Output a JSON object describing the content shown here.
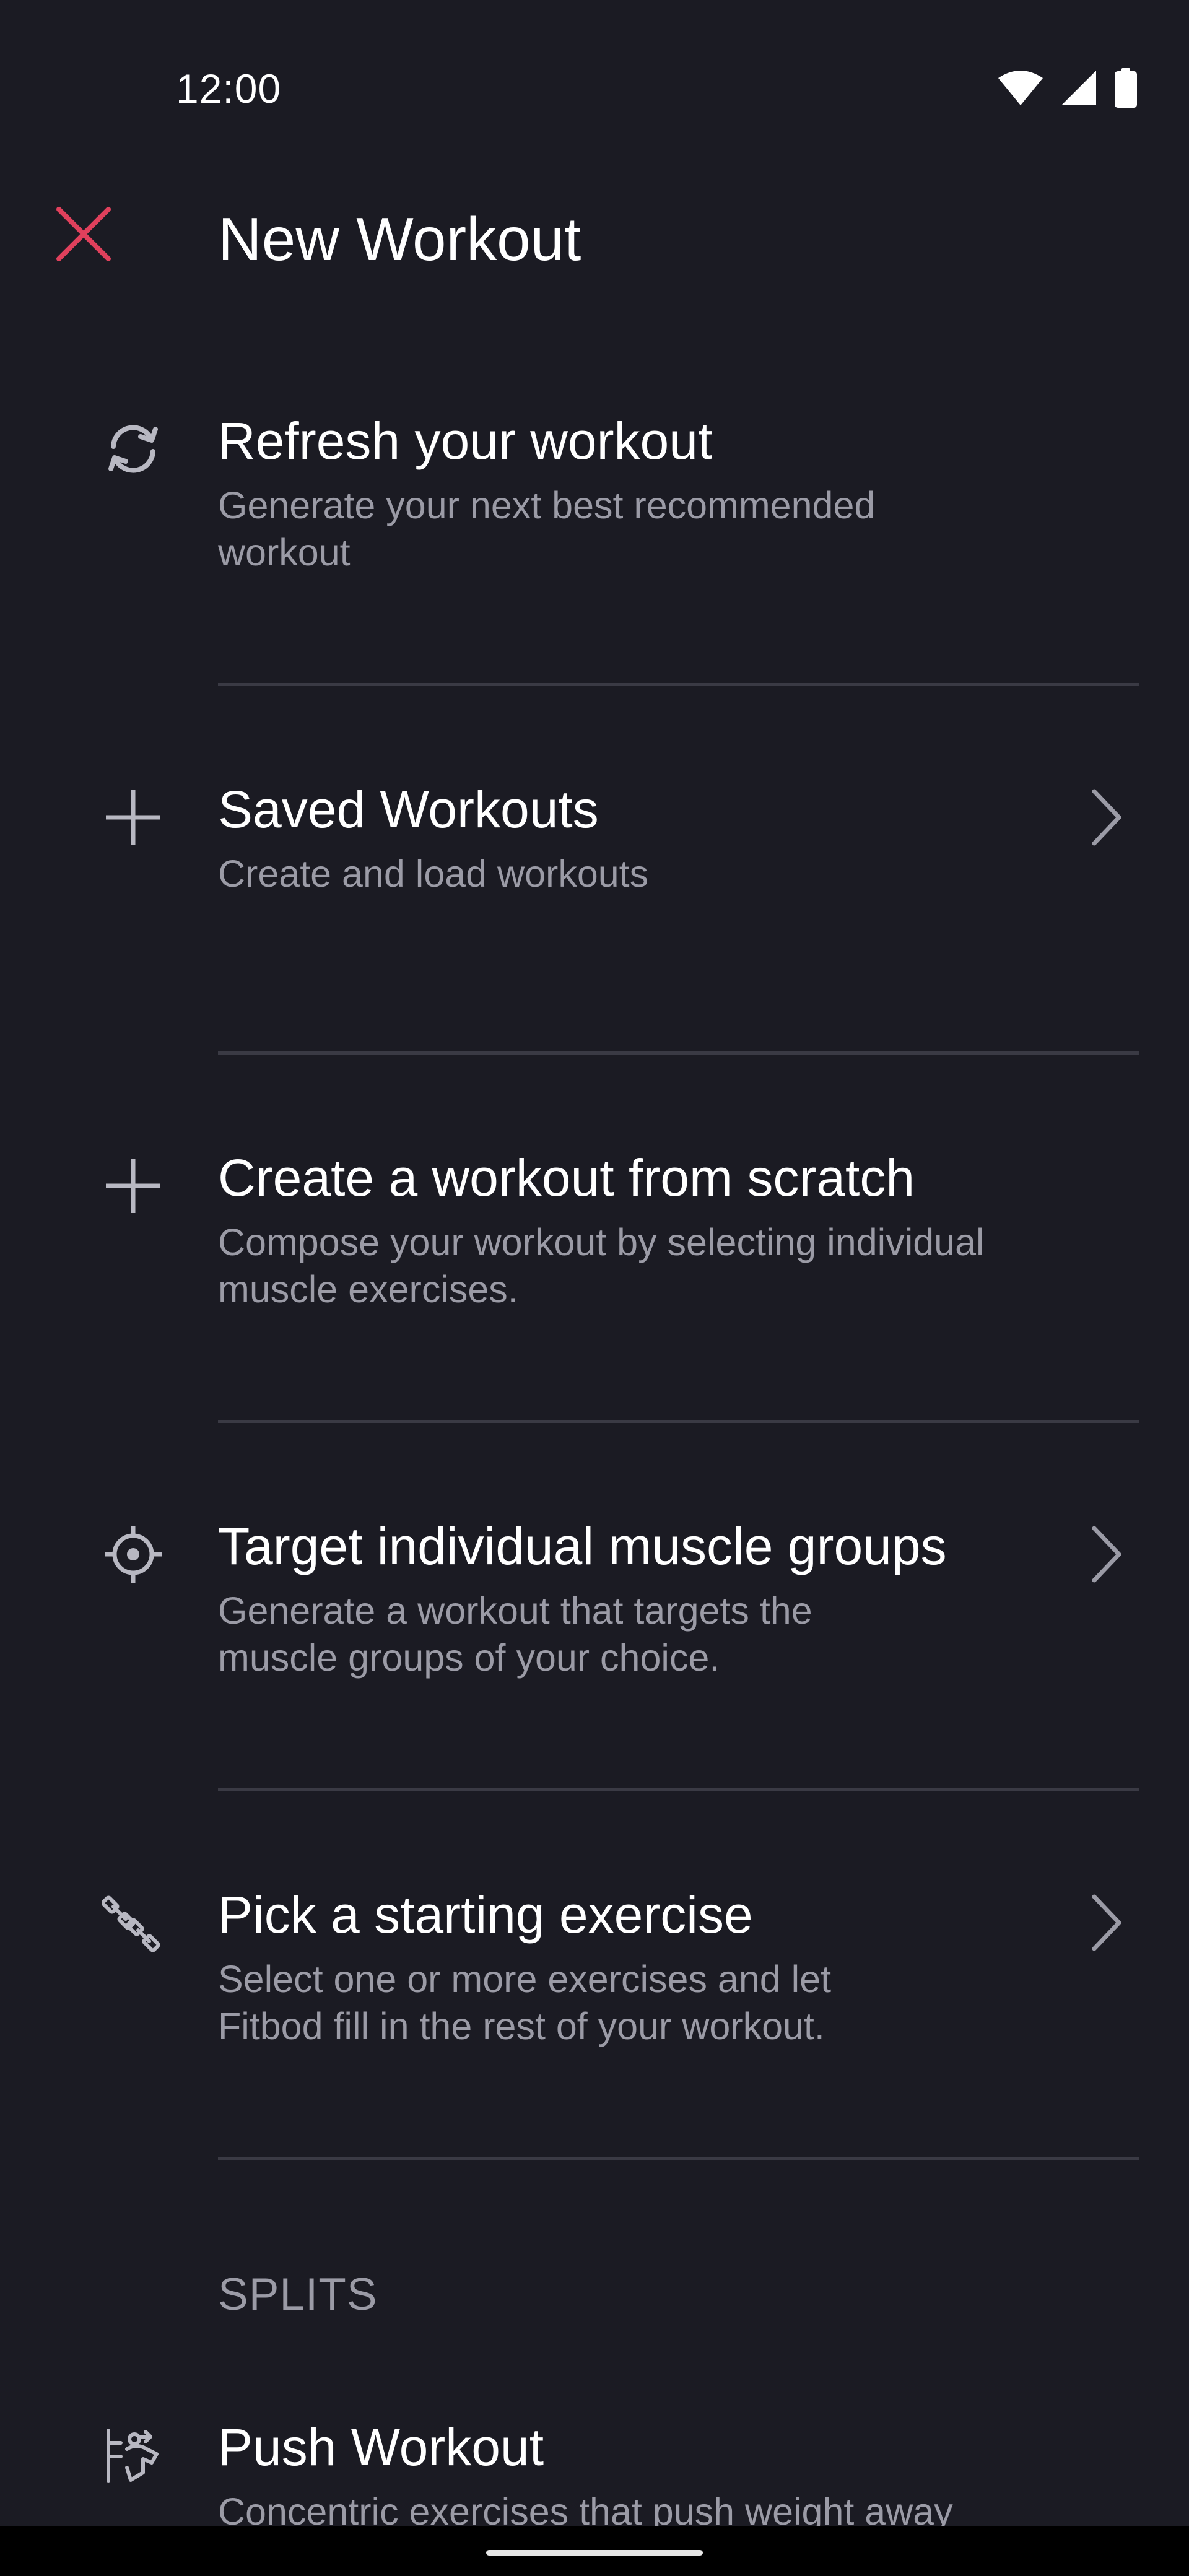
{
  "status_bar": {
    "time": "12:00"
  },
  "app_bar": {
    "title": "New Workout",
    "close_icon": "close-icon",
    "accent_color": "#e0405c"
  },
  "menu": {
    "items": [
      {
        "icon": "refresh-icon",
        "title": "Refresh your workout",
        "subtitle": "Generate your next best recommended workout",
        "has_chevron": false
      },
      {
        "icon": "plus-icon",
        "title": "Saved Workouts",
        "subtitle": "Create and load workouts",
        "has_chevron": true
      },
      {
        "icon": "plus-icon",
        "title": "Create a workout from scratch",
        "subtitle": "Compose your workout by selecting individual muscle exercises.",
        "has_chevron": false
      },
      {
        "icon": "crosshair-icon",
        "title": "Target individual muscle groups",
        "subtitle": "Generate a workout that targets the muscle groups of your choice.",
        "has_chevron": true
      },
      {
        "icon": "dumbbells-icon",
        "title": "Pick a starting exercise",
        "subtitle": "Select one or more exercises and let Fitbod fill in the rest of your workout.",
        "has_chevron": true
      }
    ]
  },
  "splits": {
    "header": "SPLITS",
    "items": [
      {
        "icon": "push-icon",
        "title": "Push Workout",
        "subtitle": "Concentric exercises that push weight away"
      }
    ]
  }
}
